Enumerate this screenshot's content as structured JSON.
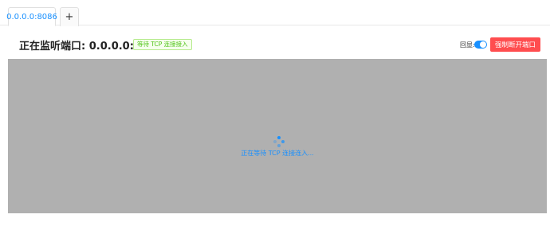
{
  "tabs": [
    {
      "label": "0.0.0.0:8086",
      "active": true
    }
  ],
  "add_tab_label": "+",
  "header": {
    "title": "正在监听端口: 0.0.0.0:8086",
    "status_tag": "等待 TCP 连接接入",
    "echo_label": "回显:",
    "echo_enabled": true,
    "disconnect_label": "强制断开端口"
  },
  "terminal": {
    "loading_text": "正在等待 TCP 连接连入..."
  },
  "colors": {
    "primary": "#1890ff",
    "danger": "#ff4d4f",
    "success": "#52c41a",
    "overlay": "#b0b0b0"
  },
  "icons": {
    "spinner": "loading-spinner-icon",
    "toggle": "echo-toggle"
  }
}
